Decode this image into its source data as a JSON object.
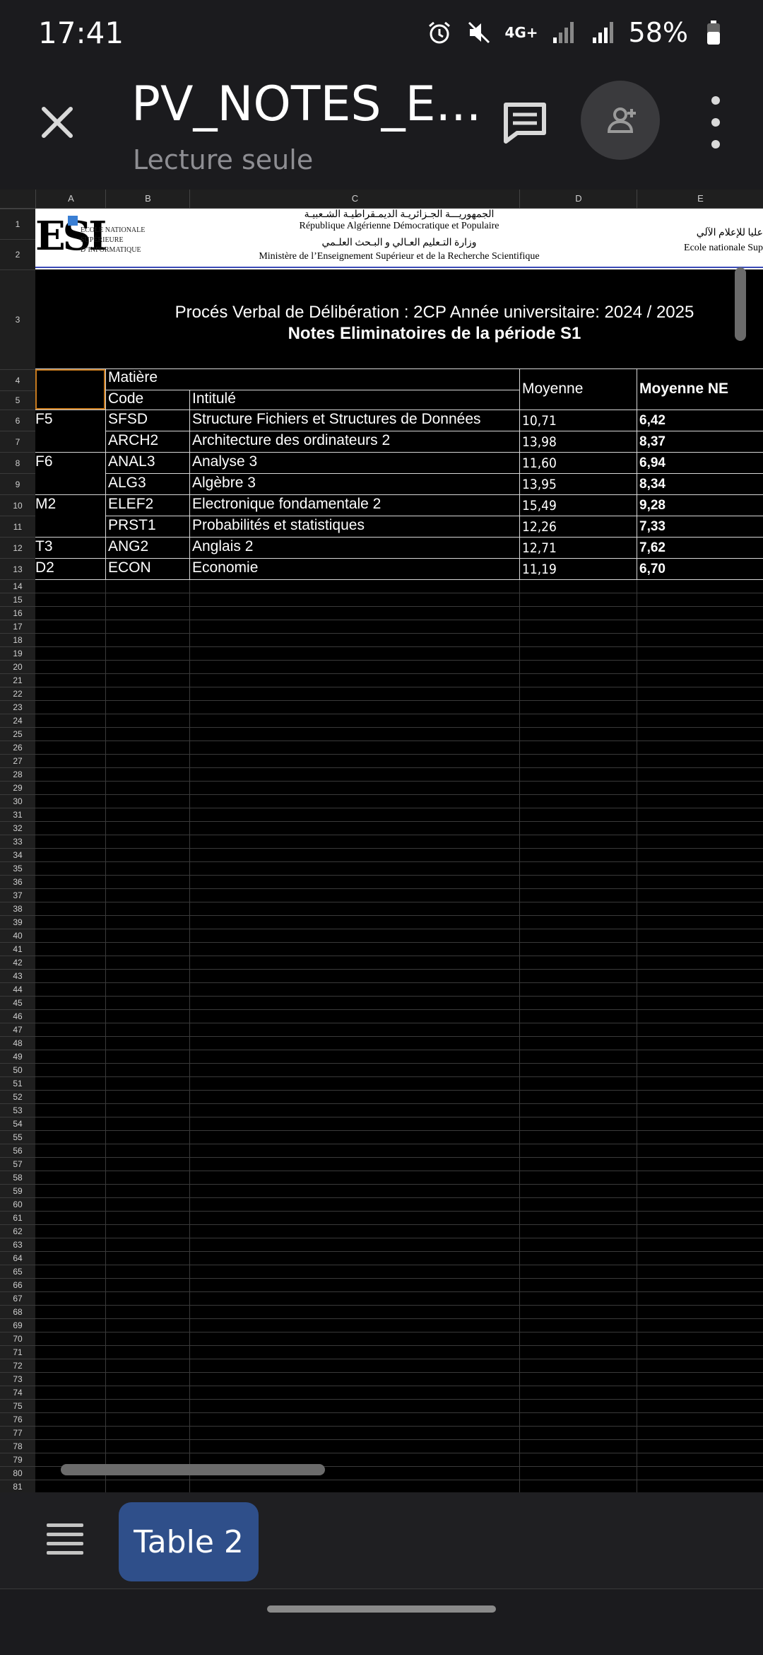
{
  "status": {
    "time": "17:41",
    "network": "4G+",
    "battery": "58%"
  },
  "header": {
    "title": "PV_NOTES_E...",
    "subtitle": "Lecture seule"
  },
  "sheet": {
    "columns": [
      "A",
      "B",
      "C",
      "D",
      "E"
    ],
    "banner": {
      "arabic_republic": "الجمهوريـــة الجـزائريـة الديمـقراطيـة الشـعبيـة",
      "republic": "République Algérienne Démocratique et Populaire",
      "arabic_ministry": "وزارة التـعليم العـالي و البـحث العلـمي",
      "ministry": "Ministère de l’Enseignement Supérieur et de la Recherche Scientifique",
      "school_lines": [
        "ECOLE NATIONALE",
        "SUPÉRIEURE",
        "D’INFORMATIQUE"
      ],
      "right_arabic": "عليا للإعلام الآلي",
      "right_french": "Ecole nationale Sup"
    },
    "title_line1": "Procés Verbal de Délibération : 2CP Année universitaire: 2024 / 2025",
    "title_line2": "Notes Eliminatoires de la période S1",
    "headers": {
      "matiere": "Matière",
      "code": "Code",
      "intitule": "Intitulé",
      "moyenne": "Moyenne",
      "moyenne_ne": "Moyenne NE"
    },
    "rows": [
      {
        "group": "F5",
        "code": "SFSD",
        "intitule": "Structure Fichiers et Structures de Données",
        "moyenne": "10,71",
        "moyenne_ne": "6,42"
      },
      {
        "group": "",
        "code": "ARCH2",
        "intitule": "Architecture des ordinateurs 2",
        "moyenne": "13,98",
        "moyenne_ne": "8,37"
      },
      {
        "group": "F6",
        "code": "ANAL3",
        "intitule": "Analyse 3",
        "moyenne": "11,60",
        "moyenne_ne": "6,94"
      },
      {
        "group": "",
        "code": "ALG3",
        "intitule": "Algèbre 3",
        "moyenne": "13,95",
        "moyenne_ne": "8,34"
      },
      {
        "group": "M2",
        "code": "ELEF2",
        "intitule": "Electronique fondamentale 2",
        "moyenne": "15,49",
        "moyenne_ne": "9,28"
      },
      {
        "group": "",
        "code": "PRST1",
        "intitule": "Probabilités et statistiques",
        "moyenne": "12,26",
        "moyenne_ne": "7,33"
      },
      {
        "group": "T3",
        "code": "ANG2",
        "intitule": "Anglais 2",
        "moyenne": "12,71",
        "moyenne_ne": "7,62"
      },
      {
        "group": "D2",
        "code": "ECON",
        "intitule": "Economie",
        "moyenne": "11,19",
        "moyenne_ne": "6,70"
      }
    ],
    "row_count": 81
  },
  "bottom": {
    "tab_label": "Table 2"
  }
}
